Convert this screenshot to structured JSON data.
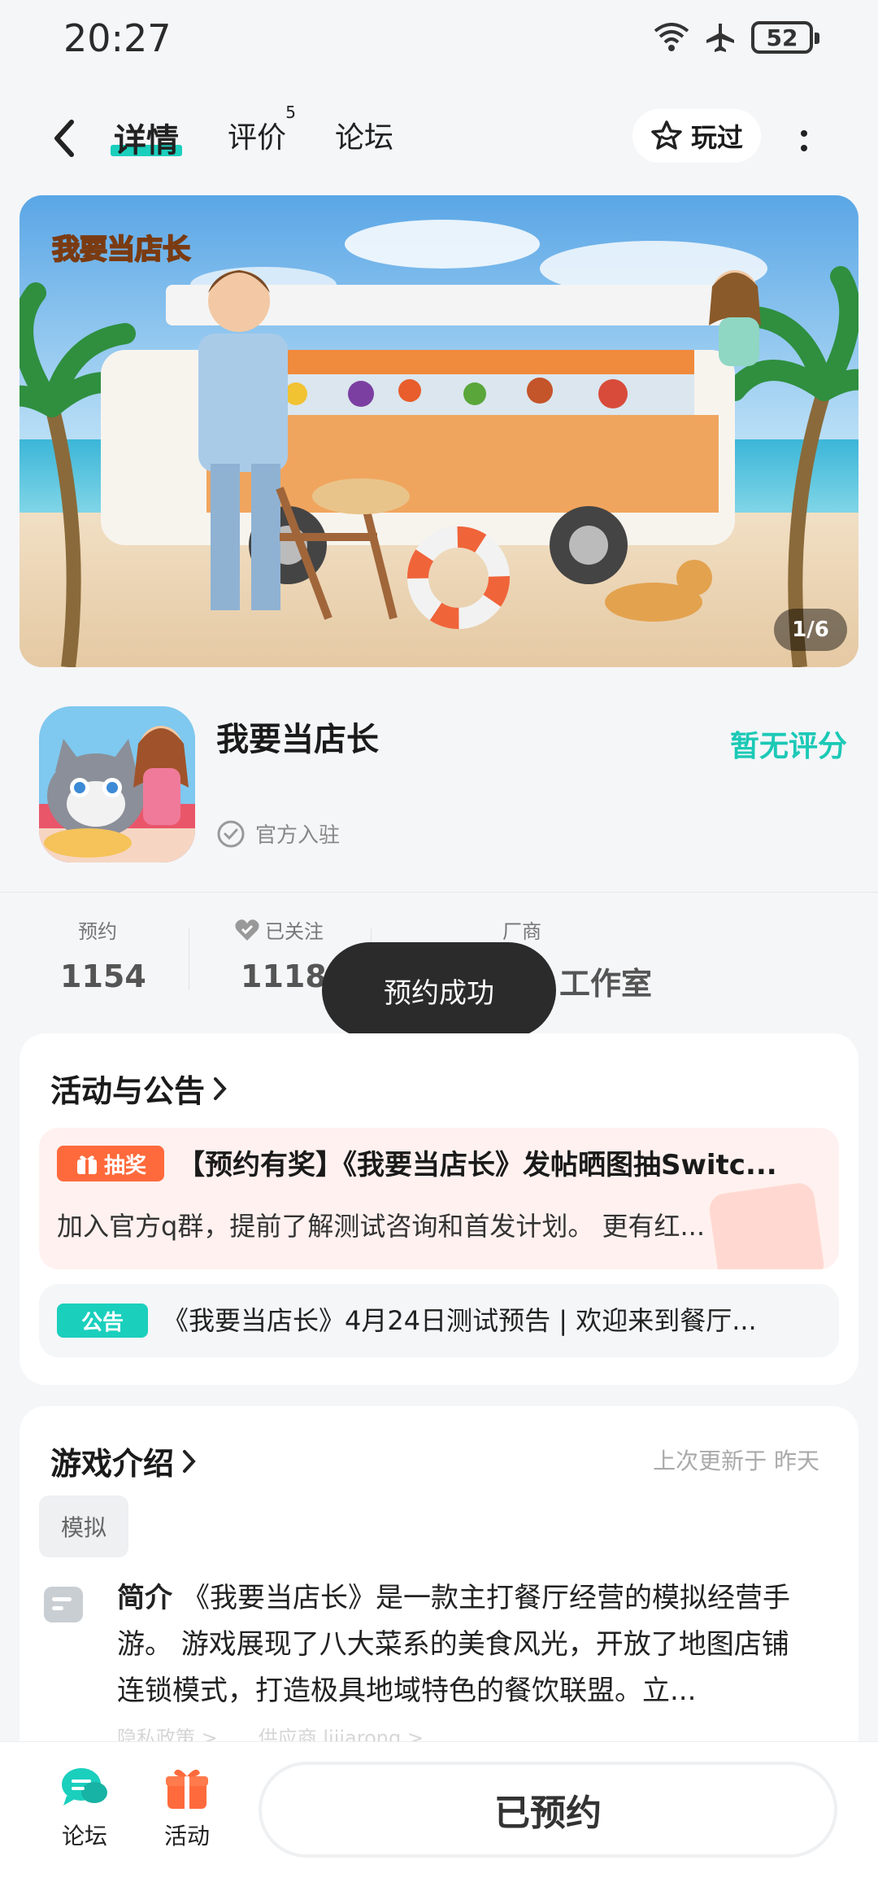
{
  "status_bar": {
    "time": "20:27",
    "battery": "52"
  },
  "nav": {
    "tabs": [
      {
        "label": "详情"
      },
      {
        "label": "评价",
        "badge": "5"
      },
      {
        "label": "论坛"
      }
    ],
    "played_label": "玩过"
  },
  "banner": {
    "counter": "1/6",
    "logo_text": "我要当店长"
  },
  "game": {
    "name": "我要当店长",
    "rating_text": "暂无评分",
    "official_label": "官方入驻"
  },
  "stats": [
    {
      "label": "预约",
      "value": "1154"
    },
    {
      "label": "已关注",
      "value": "1118"
    },
    {
      "label": "厂商",
      "value": "工作室"
    }
  ],
  "toast": "预约成功",
  "activity": {
    "title": "活动与公告",
    "lottery": {
      "tag": "抽奖",
      "title": "【预约有奖】《我要当店长》发帖晒图抽Switc...",
      "desc": "加入官方q群，提前了解测试咨询和首发计划。 更有红..."
    },
    "notice": {
      "tag": "公告",
      "title": "《我要当店长》4月24日测试预告 | 欢迎来到餐厅..."
    }
  },
  "intro": {
    "title": "游戏介绍",
    "update_time": "上次更新于 昨天",
    "genre": "模拟",
    "summary_label": "简介",
    "summary": "《我要当店长》是一款主打餐厅经营的模拟经营手游。 游戏展现了八大菜系的美食风光，开放了地图店铺连锁模式，打造极具地域特色的餐饮联盟。立...",
    "faded_links": [
      "隐私政策 >",
      "供应商 lijiarong >"
    ]
  },
  "bottom": {
    "forum_label": "论坛",
    "activity_label": "活动",
    "reserved_label": "已预约"
  },
  "colors": {
    "accent": "#1bcfbd",
    "lottery": "#ff6a3c",
    "toast_bg": "#2b2b2b"
  }
}
